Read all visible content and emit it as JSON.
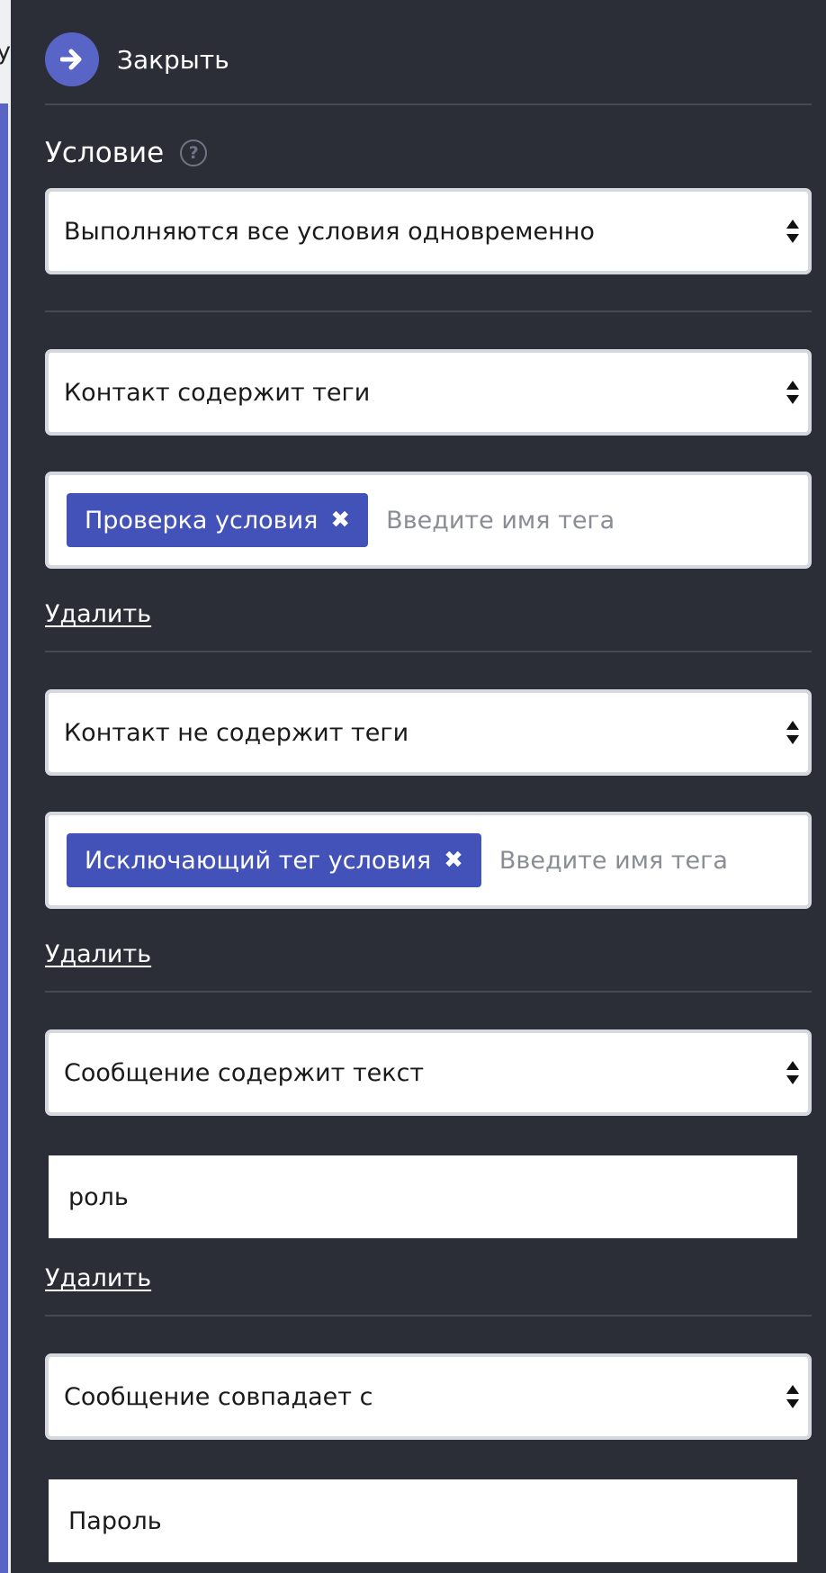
{
  "background_peek_text": "у",
  "header": {
    "close_label": "Закрыть"
  },
  "condition": {
    "title": "Условие",
    "help_symbol": "?",
    "mode_value": "Выполняются все условия одновременно"
  },
  "rules": [
    {
      "type_value": "Контакт содержит теги",
      "tag": "Проверка условия",
      "tag_placeholder": "Введите имя тега",
      "delete_label": "Удалить"
    },
    {
      "type_value": "Контакт не содержит теги",
      "tag": "Исключающий тег условия",
      "tag_placeholder": "Введите имя тега",
      "delete_label": "Удалить"
    },
    {
      "type_value": "Сообщение содержит текст",
      "text_value": "роль",
      "delete_label": "Удалить"
    },
    {
      "type_value": "Сообщение совпадает с",
      "text_value": "Пароль"
    }
  ],
  "tag_remove_symbol": "✖",
  "colors": {
    "panel_bg": "#2b2e37",
    "accent": "#5865c6",
    "tag_bg": "#4352b8",
    "divider": "#444955"
  },
  "icons": {
    "close": "arrow-right-icon",
    "help": "question-circle-icon",
    "select": "sort-arrows-icon",
    "tag_remove": "times-icon"
  }
}
